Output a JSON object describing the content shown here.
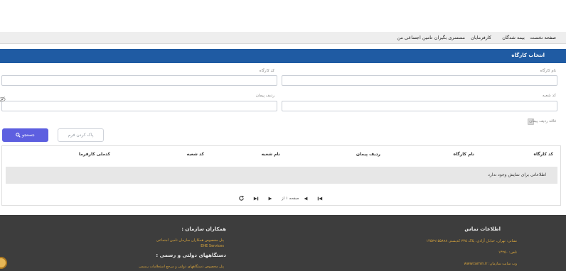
{
  "nav": {
    "items": [
      "صفحه نخست",
      "بیمه شدگان",
      "کارفرمایان",
      "مستمری بگیران",
      "تامین اجتماعی من"
    ]
  },
  "card": {
    "title": "انتخاب کارگاه"
  },
  "form": {
    "workshop_name_label": "نام کارگاه",
    "workshop_code_label": "کد کارگاه",
    "branch_code_label": "کد شعبه",
    "contract_row_label": "ردیف پیمان",
    "checkbox_label": "فاقد ردیف پیمان",
    "clear_label": "پاک کردن فرم",
    "search_label": "جستجو"
  },
  "table": {
    "headers": [
      "کد کارگاه",
      "نام کارگاه",
      "ردیف پیمان",
      "نام شعبه",
      "کد شعبه",
      "کدملی کارفرما"
    ],
    "empty_message": "اطلاعاتی برای نمایش وجود ندارد",
    "pager_text": "صفحه ۱ از"
  },
  "footer": {
    "contact_title": "اطلاعات تماس",
    "address": "نشانی: تهران، خیابان آزادی، پلاک ۳۳۵ کدپستی ۱۴۵۷۹۱۵۵۸۹۸",
    "phone": "تلفن: ۱۴۲۵۰",
    "website": "وب سایت سازمان: www.tamin.ir",
    "partners_title": "همکاران سازمان :",
    "partners_line1": "پنل مخصوص همکاران سازمان تامین اجتماعی",
    "partners_line2": "EHE Services",
    "gov_title": "دستگاههای دولتی و رسمی :",
    "gov_line1": "پنل مخصوص دستگاههای دولتی و مرجع استعلامات رسمی"
  },
  "colors": {
    "header_blue": "#1f5ba3",
    "search_button": "#5d5fe0",
    "footer_bg": "#3d3d3d",
    "footer_accent": "#d9a53b"
  },
  "icons": {
    "search": "search-icon",
    "refresh": "refresh-icon",
    "first": "first-page-icon",
    "prev": "previous-page-icon",
    "next": "next-page-icon",
    "last": "last-page-icon",
    "eye": "eye-icon"
  }
}
